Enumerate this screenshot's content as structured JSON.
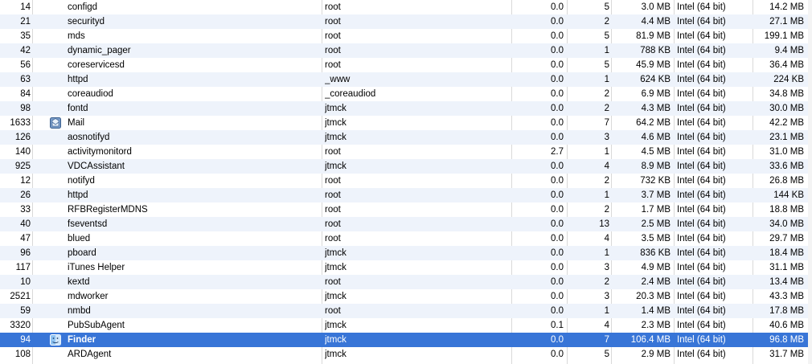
{
  "colors": {
    "selection": "#3875d7",
    "alt_row": "#eef3fb",
    "grid_line": "#d9d9d9"
  },
  "processes": [
    {
      "pid": "14",
      "name": "configd",
      "user": "root",
      "cpu": "0.0",
      "threads": "5",
      "real_mem": "3.0 MB",
      "kind": "Intel (64 bit)",
      "virt_mem": "14.2 MB"
    },
    {
      "pid": "21",
      "name": "securityd",
      "user": "root",
      "cpu": "0.0",
      "threads": "2",
      "real_mem": "4.4 MB",
      "kind": "Intel (64 bit)",
      "virt_mem": "27.1 MB"
    },
    {
      "pid": "35",
      "name": "mds",
      "user": "root",
      "cpu": "0.0",
      "threads": "5",
      "real_mem": "81.9 MB",
      "kind": "Intel (64 bit)",
      "virt_mem": "199.1 MB"
    },
    {
      "pid": "42",
      "name": "dynamic_pager",
      "user": "root",
      "cpu": "0.0",
      "threads": "1",
      "real_mem": "788 KB",
      "kind": "Intel (64 bit)",
      "virt_mem": "9.4 MB"
    },
    {
      "pid": "56",
      "name": "coreservicesd",
      "user": "root",
      "cpu": "0.0",
      "threads": "5",
      "real_mem": "45.9 MB",
      "kind": "Intel (64 bit)",
      "virt_mem": "36.4 MB"
    },
    {
      "pid": "63",
      "name": "httpd",
      "user": "_www",
      "cpu": "0.0",
      "threads": "1",
      "real_mem": "624 KB",
      "kind": "Intel (64 bit)",
      "virt_mem": "224 KB"
    },
    {
      "pid": "84",
      "name": "coreaudiod",
      "user": "_coreaudiod",
      "cpu": "0.0",
      "threads": "2",
      "real_mem": "6.9 MB",
      "kind": "Intel (64 bit)",
      "virt_mem": "34.8 MB"
    },
    {
      "pid": "98",
      "name": "fontd",
      "user": "jtmck",
      "cpu": "0.0",
      "threads": "2",
      "real_mem": "4.3 MB",
      "kind": "Intel (64 bit)",
      "virt_mem": "30.0 MB"
    },
    {
      "pid": "1633",
      "name": "Mail",
      "user": "jtmck",
      "cpu": "0.0",
      "threads": "7",
      "real_mem": "64.2 MB",
      "kind": "Intel (64 bit)",
      "virt_mem": "42.2 MB",
      "icon": "mail-app-icon"
    },
    {
      "pid": "126",
      "name": "aosnotifyd",
      "user": "jtmck",
      "cpu": "0.0",
      "threads": "3",
      "real_mem": "4.6 MB",
      "kind": "Intel (64 bit)",
      "virt_mem": "23.1 MB"
    },
    {
      "pid": "140",
      "name": "activitymonitord",
      "user": "root",
      "cpu": "2.7",
      "threads": "1",
      "real_mem": "4.5 MB",
      "kind": "Intel (64 bit)",
      "virt_mem": "31.0 MB"
    },
    {
      "pid": "925",
      "name": "VDCAssistant",
      "user": "jtmck",
      "cpu": "0.0",
      "threads": "4",
      "real_mem": "8.9 MB",
      "kind": "Intel (64 bit)",
      "virt_mem": "33.6 MB"
    },
    {
      "pid": "12",
      "name": "notifyd",
      "user": "root",
      "cpu": "0.0",
      "threads": "2",
      "real_mem": "732 KB",
      "kind": "Intel (64 bit)",
      "virt_mem": "26.8 MB"
    },
    {
      "pid": "26",
      "name": "httpd",
      "user": "root",
      "cpu": "0.0",
      "threads": "1",
      "real_mem": "3.7 MB",
      "kind": "Intel (64 bit)",
      "virt_mem": "144 KB"
    },
    {
      "pid": "33",
      "name": "RFBRegisterMDNS",
      "user": "root",
      "cpu": "0.0",
      "threads": "2",
      "real_mem": "1.7 MB",
      "kind": "Intel (64 bit)",
      "virt_mem": "18.8 MB"
    },
    {
      "pid": "40",
      "name": "fseventsd",
      "user": "root",
      "cpu": "0.0",
      "threads": "13",
      "real_mem": "2.5 MB",
      "kind": "Intel (64 bit)",
      "virt_mem": "34.0 MB"
    },
    {
      "pid": "47",
      "name": "blued",
      "user": "root",
      "cpu": "0.0",
      "threads": "4",
      "real_mem": "3.5 MB",
      "kind": "Intel (64 bit)",
      "virt_mem": "29.7 MB"
    },
    {
      "pid": "96",
      "name": "pboard",
      "user": "jtmck",
      "cpu": "0.0",
      "threads": "1",
      "real_mem": "836 KB",
      "kind": "Intel (64 bit)",
      "virt_mem": "18.4 MB"
    },
    {
      "pid": "117",
      "name": "iTunes Helper",
      "user": "jtmck",
      "cpu": "0.0",
      "threads": "3",
      "real_mem": "4.9 MB",
      "kind": "Intel (64 bit)",
      "virt_mem": "31.1 MB"
    },
    {
      "pid": "10",
      "name": "kextd",
      "user": "root",
      "cpu": "0.0",
      "threads": "2",
      "real_mem": "2.4 MB",
      "kind": "Intel (64 bit)",
      "virt_mem": "13.4 MB"
    },
    {
      "pid": "2521",
      "name": "mdworker",
      "user": "jtmck",
      "cpu": "0.0",
      "threads": "3",
      "real_mem": "20.3 MB",
      "kind": "Intel (64 bit)",
      "virt_mem": "43.3 MB"
    },
    {
      "pid": "59",
      "name": "nmbd",
      "user": "root",
      "cpu": "0.0",
      "threads": "1",
      "real_mem": "1.4 MB",
      "kind": "Intel (64 bit)",
      "virt_mem": "17.8 MB"
    },
    {
      "pid": "3320",
      "name": "PubSubAgent",
      "user": "jtmck",
      "cpu": "0.1",
      "threads": "4",
      "real_mem": "2.3 MB",
      "kind": "Intel (64 bit)",
      "virt_mem": "40.6 MB"
    },
    {
      "pid": "94",
      "name": "Finder",
      "user": "jtmck",
      "cpu": "0.0",
      "threads": "7",
      "real_mem": "106.4 MB",
      "kind": "Intel (64 bit)",
      "virt_mem": "96.8 MB",
      "icon": "finder-app-icon",
      "selected": true
    },
    {
      "pid": "108",
      "name": "ARDAgent",
      "user": "jtmck",
      "cpu": "0.0",
      "threads": "5",
      "real_mem": "2.9 MB",
      "kind": "Intel (64 bit)",
      "virt_mem": "31.7 MB"
    }
  ]
}
